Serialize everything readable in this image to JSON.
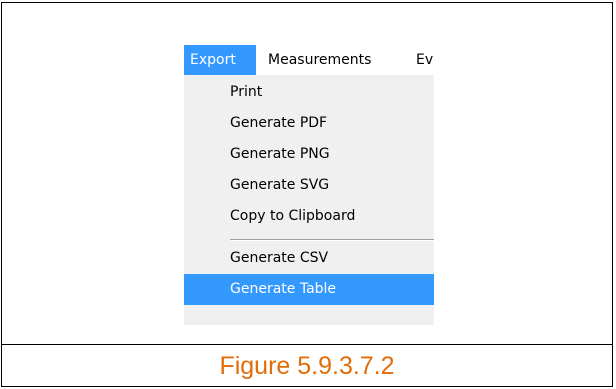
{
  "menubar": {
    "items": [
      {
        "label": "Export",
        "active": true
      },
      {
        "label": "Measurements",
        "active": false
      },
      {
        "label": "Ev",
        "active": false
      }
    ]
  },
  "export_menu": {
    "items": [
      {
        "label": "Print"
      },
      {
        "label": "Generate PDF"
      },
      {
        "label": "Generate PNG"
      },
      {
        "label": "Generate SVG"
      },
      {
        "label": "Copy to Clipboard"
      },
      {
        "label": "Generate CSV"
      },
      {
        "label": "Generate Table",
        "highlighted": true
      }
    ]
  },
  "caption": "Figure 5.9.3.7.2",
  "colors": {
    "highlight": "#3399ff",
    "menu_background": "#f0f0f0",
    "caption": "#e36c0a"
  }
}
